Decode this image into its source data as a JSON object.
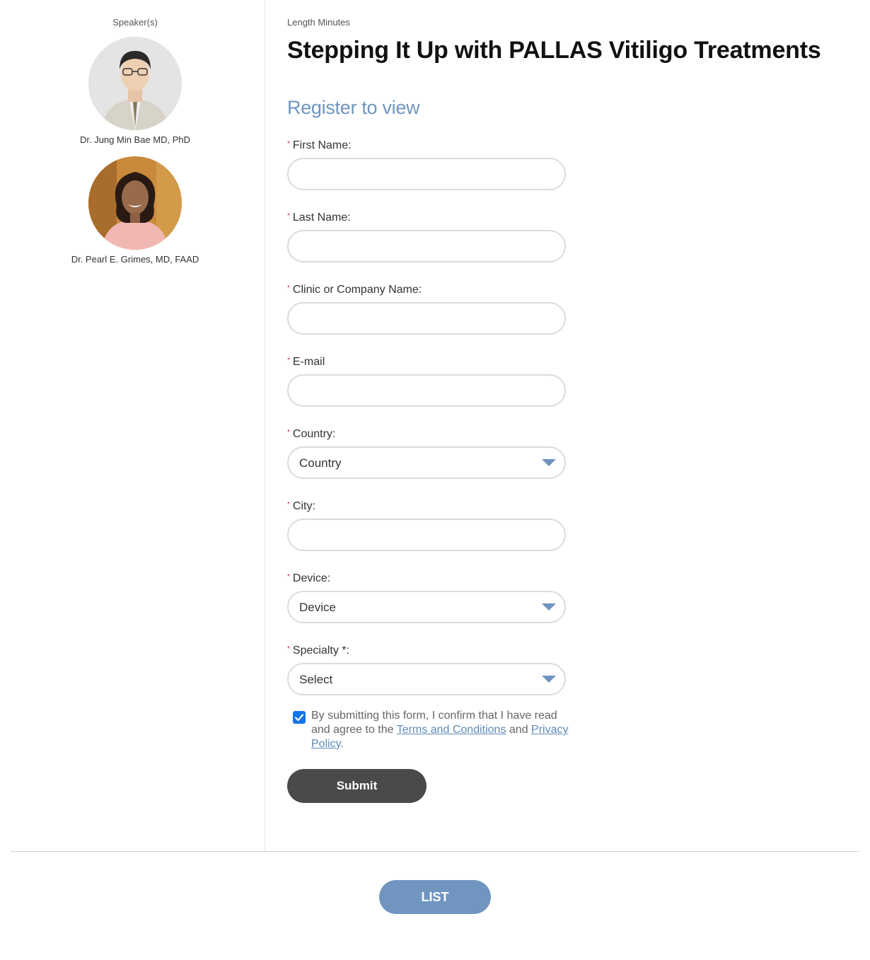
{
  "sidebar": {
    "heading": "Speaker(s)",
    "speakers": [
      {
        "name": "Dr. Jung Min Bae MD, PhD"
      },
      {
        "name": "Dr. Pearl E. Grimes, MD, FAAD"
      }
    ]
  },
  "main": {
    "length_label": "Length Minutes",
    "title": "Stepping It Up with PALLAS Vitiligo Treatments",
    "register_heading": "Register to view"
  },
  "form": {
    "required_mark": "*",
    "first_name_label": "First Name:",
    "last_name_label": "Last Name:",
    "clinic_label": "Clinic or Company Name:",
    "email_label": "E-mail",
    "country_label": "Country:",
    "country_value": "Country",
    "city_label": "City:",
    "device_label": "Device:",
    "device_value": "Device",
    "specialty_label": "Specialty *:",
    "specialty_value": "Select",
    "consent_checked": true,
    "consent_prefix": "By submitting this form, I confirm that I have read and agree to the ",
    "terms_link": "Terms and Conditions",
    "consent_and": " and ",
    "privacy_link": "Privacy Policy",
    "consent_end": ".",
    "submit_label": "Submit"
  },
  "footer": {
    "list_label": "LIST"
  },
  "colors": {
    "accent": "#7096c0",
    "submit_bg": "#4a4a4a",
    "required": "#c8373b",
    "checkbox": "#1473e6"
  }
}
